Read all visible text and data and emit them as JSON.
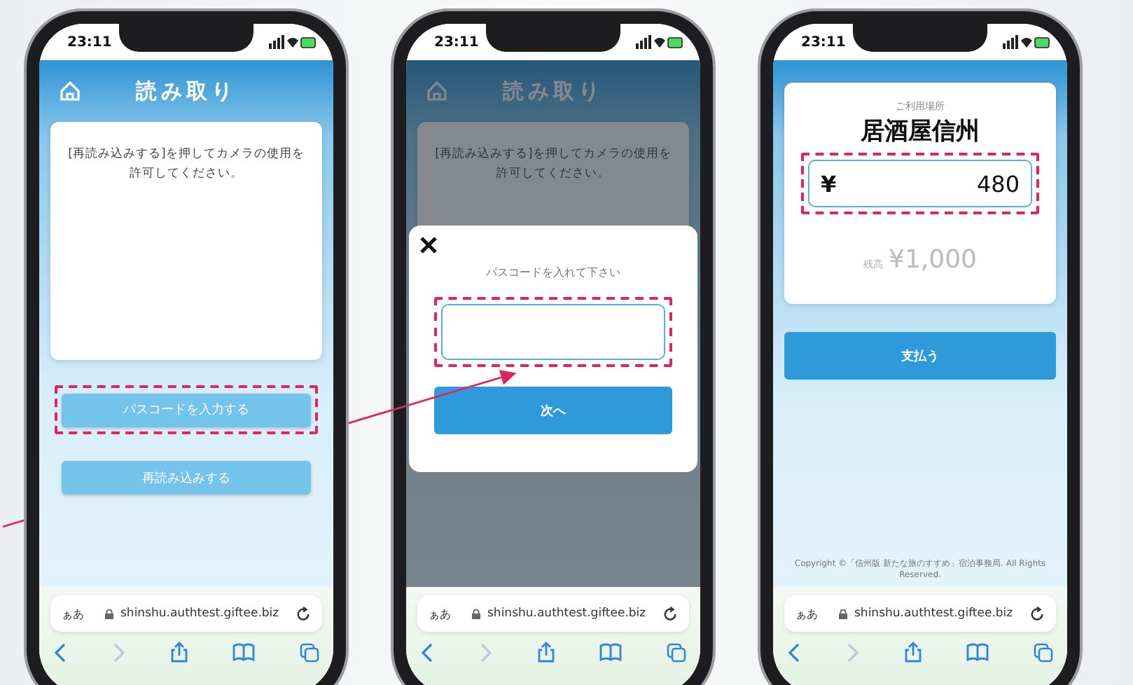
{
  "phones": [
    {
      "kind": "scan",
      "status_time": "23:11",
      "title": "読み取り",
      "message": "[再読み込みする]を押してカメラの使用を許可してください。",
      "dimmed": false,
      "buttons": [
        {
          "label": "パスコードを入力する",
          "highlighted": true
        },
        {
          "label": "再読み込みする",
          "highlighted": false
        }
      ],
      "browser": {
        "text_size": "ぁあ",
        "url": "shinshu.authtest.giftee.biz"
      }
    },
    {
      "kind": "scan",
      "status_time": "23:11",
      "title": "読み取り",
      "message": "[再読み込みする]を押してカメラの使用を許可してください。",
      "dimmed": true,
      "modal": {
        "prompt": "パスコードを入れて下さい",
        "input_highlighted": true,
        "button": "次へ"
      },
      "browser": {
        "text_size": "ぁあ",
        "url": "shinshu.authtest.giftee.biz"
      }
    },
    {
      "kind": "payment",
      "status_time": "23:11",
      "venue_label": "ご利用場所",
      "venue": "居酒屋信州",
      "currency": "¥",
      "amount": "480",
      "amount_highlighted": true,
      "balance_label": "残高",
      "balance": "¥1,000",
      "button": "支払う",
      "copyright": "Copyright ©「信州版 新たな旅のすすめ」宿泊事務局. All Rights Reserved.",
      "browser": {
        "text_size": "ぁあ",
        "url": "shinshu.authtest.giftee.biz"
      }
    }
  ]
}
